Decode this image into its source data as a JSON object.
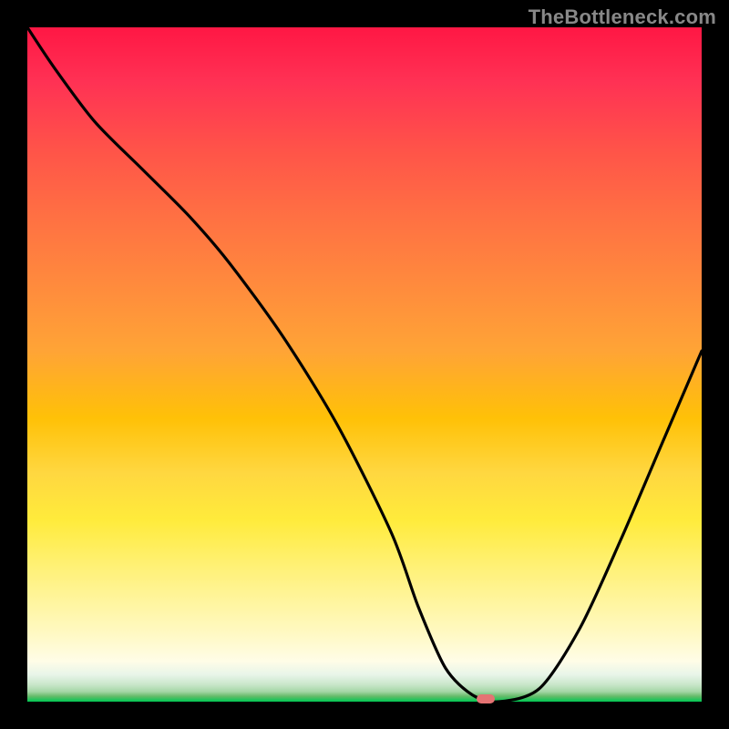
{
  "watermark": "TheBottleneck.com",
  "chart_data": {
    "type": "line",
    "title": "",
    "xlabel": "",
    "ylabel": "",
    "xlim": [
      0,
      100
    ],
    "ylim": [
      0,
      100
    ],
    "grid": false,
    "series": [
      {
        "name": "bottleneck-curve",
        "x": [
          0,
          4,
          10,
          17,
          24,
          30,
          38,
          46,
          54,
          58,
          62,
          66,
          70,
          76,
          82,
          88,
          94,
          100
        ],
        "y": [
          100,
          94,
          86,
          79,
          72,
          65,
          54,
          41,
          25,
          14,
          5,
          1,
          0,
          2,
          11,
          24,
          38,
          52
        ]
      }
    ],
    "minimum_point": {
      "x": 68,
      "y": 0
    },
    "background_gradient": {
      "top": "#ff1744",
      "mid": "#ffeb3b",
      "bottom": "#00c853"
    },
    "marker_color": "#e57373",
    "frame_color": "#000000"
  }
}
